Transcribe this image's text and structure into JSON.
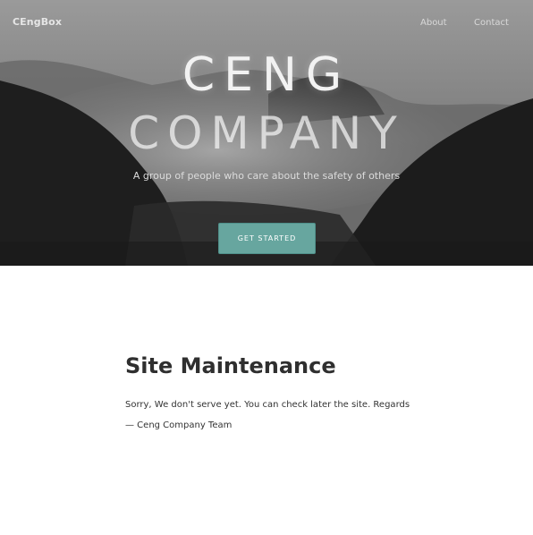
{
  "navbar": {
    "brand": "CEngBox",
    "links": [
      {
        "label": "About"
      },
      {
        "label": "Contact"
      }
    ]
  },
  "hero": {
    "title_line1": "CENG",
    "title_line2": "COMPANY",
    "subtitle": "A group of people who care about the safety of others",
    "cta_label": "GET STARTED",
    "cta_color": "#67a69f"
  },
  "content": {
    "heading": "Site Maintenance",
    "message": "Sorry, We don't serve yet. You can check later the site. Regards",
    "signature": "— Ceng Company Team"
  }
}
